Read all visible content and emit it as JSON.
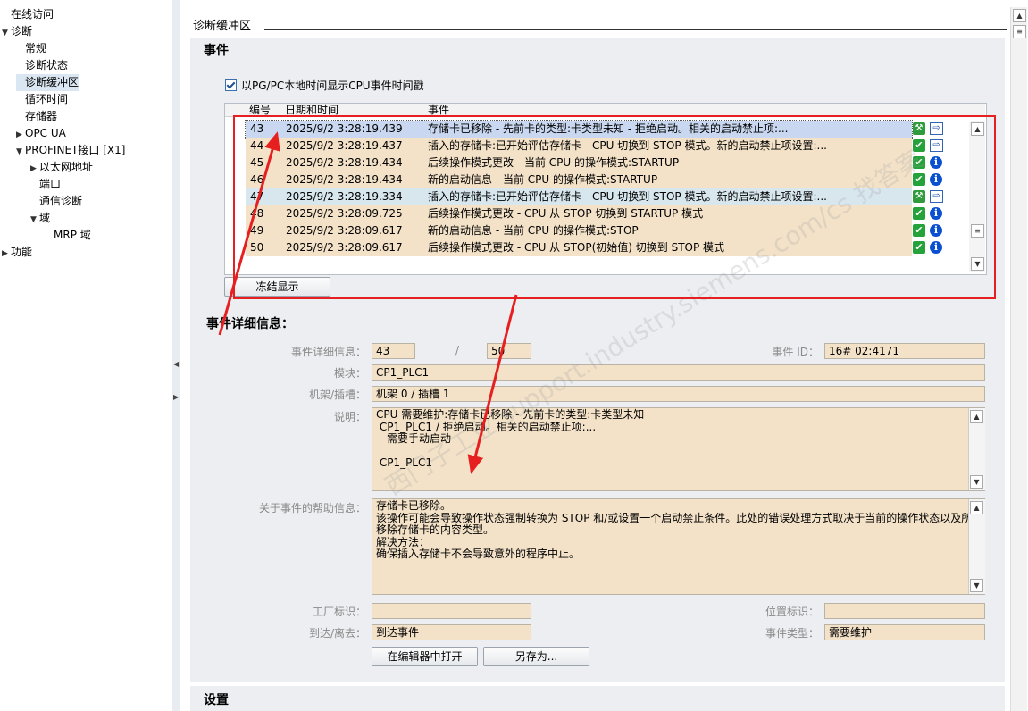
{
  "tree": {
    "items": [
      {
        "label": "在线访问",
        "indent": 0,
        "arrow": "",
        "selected": false
      },
      {
        "label": "诊断",
        "indent": 0,
        "arrow": "▼",
        "selected": false
      },
      {
        "label": "常规",
        "indent": 1,
        "arrow": "",
        "selected": false
      },
      {
        "label": "诊断状态",
        "indent": 1,
        "arrow": "",
        "selected": false
      },
      {
        "label": "诊断缓冲区",
        "indent": 1,
        "arrow": "",
        "selected": true
      },
      {
        "label": "循环时间",
        "indent": 1,
        "arrow": "",
        "selected": false
      },
      {
        "label": "存储器",
        "indent": 1,
        "arrow": "",
        "selected": false
      },
      {
        "label": "OPC UA",
        "indent": 1,
        "arrow": "▶",
        "selected": false
      },
      {
        "label": "PROFINET接口 [X1]",
        "indent": 1,
        "arrow": "▼",
        "selected": false
      },
      {
        "label": "以太网地址",
        "indent": 2,
        "arrow": "▶",
        "selected": false
      },
      {
        "label": "端口",
        "indent": 2,
        "arrow": "",
        "selected": false
      },
      {
        "label": "通信诊断",
        "indent": 2,
        "arrow": "",
        "selected": false
      },
      {
        "label": "域",
        "indent": 2,
        "arrow": "▼",
        "selected": false
      },
      {
        "label": "MRP 域",
        "indent": 3,
        "arrow": "",
        "selected": false
      },
      {
        "label": "功能",
        "indent": 0,
        "arrow": "▶",
        "selected": false
      }
    ]
  },
  "pane": {
    "title": "诊断缓冲区",
    "section_events": "事件",
    "checkbox_label": "以PG/PC本地时间显示CPU事件时间戳",
    "col_number": "编号",
    "col_datetime": "日期和时间",
    "col_event": "事件",
    "freeze_button": "冻结显示"
  },
  "events": [
    {
      "no": "43",
      "time": "2025/9/2 3:28:19.439",
      "text": "存储卡已移除 - 先前卡的类型:卡类型未知  - 拒绝启动。相关的启动禁止项:...",
      "icon": "wrench",
      "icon2": "arrow",
      "bg": "#c9d8f0",
      "selected": true
    },
    {
      "no": "44",
      "time": "2025/9/2 3:28:19.437",
      "text": "插入的存储卡:已开始评估存储卡  - CPU 切换到 STOP 模式。新的启动禁止项设置:...",
      "icon": "ok",
      "icon2": "arrow",
      "bg": "#f3e2c8",
      "selected": false
    },
    {
      "no": "45",
      "time": "2025/9/2 3:28:19.434",
      "text": "后续操作模式更改  - 当前 CPU 的操作模式:STARTUP",
      "icon": "ok",
      "icon2": "info",
      "bg": "#f3e2c8",
      "selected": false
    },
    {
      "no": "46",
      "time": "2025/9/2 3:28:19.434",
      "text": "新的启动信息 - 当前 CPU 的操作模式:STARTUP",
      "icon": "ok",
      "icon2": "info",
      "bg": "#f3e2c8",
      "selected": false
    },
    {
      "no": "47",
      "time": "2025/9/2 3:28:19.334",
      "text": "插入的存储卡:已开始评估存储卡  - CPU 切换到 STOP 模式。新的启动禁止项设置:...",
      "icon": "wrench",
      "icon2": "arrow",
      "bg": "#d8e6ee",
      "selected": false
    },
    {
      "no": "48",
      "time": "2025/9/2 3:28:09.725",
      "text": "后续操作模式更改  - CPU 从 STOP 切换到 STARTUP 模式",
      "icon": "ok",
      "icon2": "info",
      "bg": "#f3e2c8",
      "selected": false
    },
    {
      "no": "49",
      "time": "2025/9/2 3:28:09.617",
      "text": "新的启动信息 - 当前 CPU 的操作模式:STOP",
      "icon": "ok",
      "icon2": "info",
      "bg": "#f3e2c8",
      "selected": false
    },
    {
      "no": "50",
      "time": "2025/9/2 3:28:09.617",
      "text": "后续操作模式更改  - CPU 从 STOP(初始值) 切换到 STOP 模式",
      "icon": "ok",
      "icon2": "info",
      "bg": "#f3e2c8",
      "selected": false
    }
  ],
  "details": {
    "header": "事件详细信息：",
    "label_detail": "事件详细信息：",
    "detail_value": "43",
    "slash": "/",
    "detail_total": "50",
    "label_event_id": "事件 ID：",
    "event_id": "16# 02:4171",
    "label_module": "模块：",
    "module": "CP1_PLC1",
    "label_rack": "机架/插槽：",
    "rack": "机架 0 / 插槽 1",
    "label_desc": "说明：",
    "desc": "CPU 需要维护:存储卡已移除 - 先前卡的类型:卡类型未知\n CP1_PLC1 / 拒绝启动。相关的启动禁止项:...\n - 需要手动启动\n\n CP1_PLC1",
    "label_help": "关于事件的帮助信息：",
    "help": "存储卡已移除。\n该操作可能会导致操作状态强制转换为 STOP 和/或设置一个启动禁止条件。此处的错误处理方式取决于当前的操作状态以及所\n移除存储卡的内容类型。\n解决方法：\n确保插入存储卡不会导致意外的程序中止。",
    "label_plant": "工厂标识：",
    "plant": "",
    "label_location": "位置标识：",
    "location": "",
    "label_arrival": "到达/离去：",
    "arrival": "到达事件",
    "label_type": "事件类型：",
    "type": "需要维护",
    "open_button": "在编辑器中打开",
    "saveas_button": "另存为..."
  },
  "settings_header": "设置",
  "watermark": "西门子工业 support.industry.siemens.com/cs 找答案",
  "colors": {
    "field_bg": "#f3e2c8",
    "section_bg": "#eceef1",
    "annotation": "#e62020",
    "selected_row": "#c9d8f0"
  }
}
